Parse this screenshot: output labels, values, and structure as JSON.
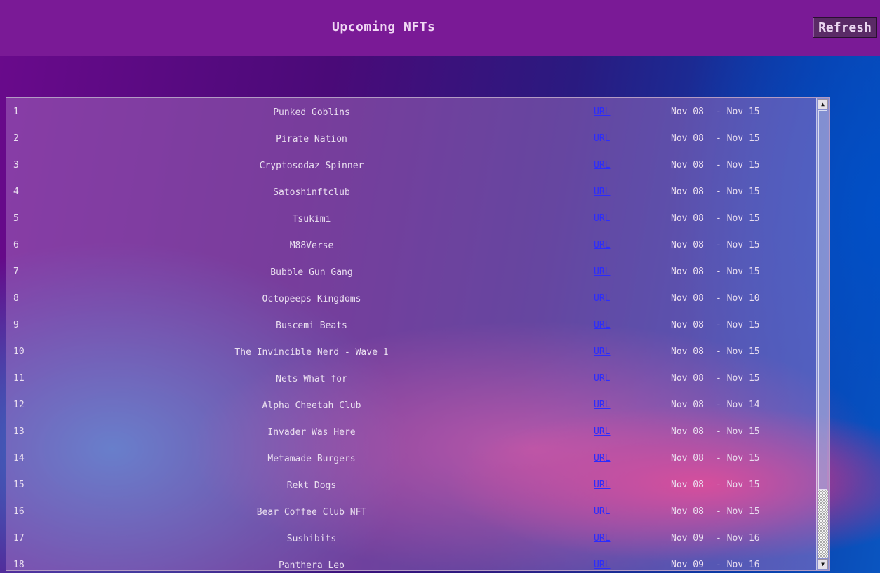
{
  "header": {
    "title": "Upcoming NFTs",
    "refresh_label": "Refresh"
  },
  "list": {
    "link_label": "URL",
    "date_separator": "- ",
    "items": [
      {
        "index": "1",
        "name": "Punked Goblins",
        "start": "Nov 08",
        "end": "Nov 15"
      },
      {
        "index": "2",
        "name": "Pirate Nation",
        "start": "Nov 08",
        "end": "Nov 15"
      },
      {
        "index": "3",
        "name": "Cryptosodaz Spinner",
        "start": "Nov 08",
        "end": "Nov 15"
      },
      {
        "index": "4",
        "name": "Satoshinftclub",
        "start": "Nov 08",
        "end": "Nov 15"
      },
      {
        "index": "5",
        "name": "Tsukimi",
        "start": "Nov 08",
        "end": "Nov 15"
      },
      {
        "index": "6",
        "name": "M88Verse",
        "start": "Nov 08",
        "end": "Nov 15"
      },
      {
        "index": "7",
        "name": "Bubble Gun Gang",
        "start": "Nov 08",
        "end": "Nov 15"
      },
      {
        "index": "8",
        "name": "Octopeeps Kingdoms",
        "start": "Nov 08",
        "end": "Nov 10"
      },
      {
        "index": "9",
        "name": "Buscemi Beats",
        "start": "Nov 08",
        "end": "Nov 15"
      },
      {
        "index": "10",
        "name": "The Invincible Nerd - Wave 1",
        "start": "Nov 08",
        "end": "Nov 15"
      },
      {
        "index": "11",
        "name": "Nets What for",
        "start": "Nov 08",
        "end": "Nov 15"
      },
      {
        "index": "12",
        "name": "Alpha Cheetah Club",
        "start": "Nov 08",
        "end": "Nov 14"
      },
      {
        "index": "13",
        "name": "Invader Was Here",
        "start": "Nov 08",
        "end": "Nov 15"
      },
      {
        "index": "14",
        "name": "Metamade Burgers",
        "start": "Nov 08",
        "end": "Nov 15"
      },
      {
        "index": "15",
        "name": "Rekt Dogs",
        "start": "Nov 08",
        "end": "Nov 15"
      },
      {
        "index": "16",
        "name": "Bear Coffee Club NFT",
        "start": "Nov 08",
        "end": "Nov 15"
      },
      {
        "index": "17",
        "name": "Sushibits",
        "start": "Nov 09",
        "end": "Nov 16"
      },
      {
        "index": "18",
        "name": "Panthera Leo",
        "start": "Nov 09",
        "end": "Nov 16"
      }
    ]
  },
  "scrollbar": {
    "up_glyph": "▲",
    "down_glyph": "▼"
  }
}
